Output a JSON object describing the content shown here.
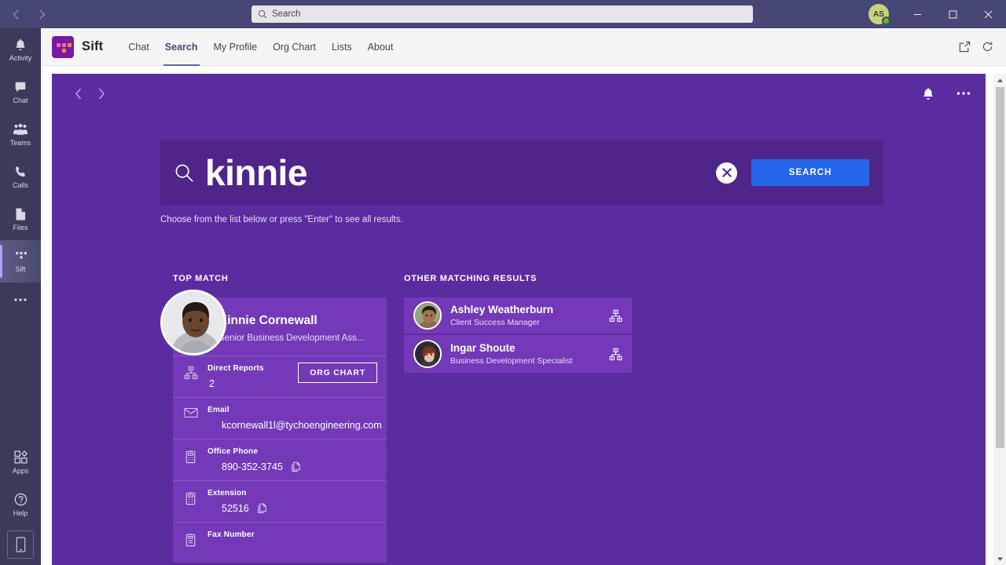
{
  "titlebar": {
    "back_label": "‹",
    "forward_label": "›",
    "search_placeholder": "Search",
    "search_icon": "search-icon",
    "avatar_initials": "AS",
    "minimize_label": "—",
    "maximize_label": "▢",
    "close_label": "✕"
  },
  "rail": {
    "items": [
      {
        "label": "Activity",
        "icon": "bell-icon"
      },
      {
        "label": "Chat",
        "icon": "chat-icon"
      },
      {
        "label": "Teams",
        "icon": "teams-icon"
      },
      {
        "label": "Calls",
        "icon": "phone-icon"
      },
      {
        "label": "Files",
        "icon": "files-icon"
      },
      {
        "label": "Sift",
        "icon": "sift-icon"
      }
    ],
    "more_label": "•••",
    "bottom": [
      {
        "label": "Apps",
        "icon": "apps-icon"
      },
      {
        "label": "Help",
        "icon": "help-icon"
      }
    ],
    "phone_icon": "mobile-device-icon"
  },
  "appheader": {
    "app_name": "Sift",
    "logo_icon": "sift-logo-icon",
    "tabs": [
      {
        "label": "Chat",
        "active": false
      },
      {
        "label": "Search",
        "active": true
      },
      {
        "label": "My Profile",
        "active": false
      },
      {
        "label": "Org Chart",
        "active": false
      },
      {
        "label": "Lists",
        "active": false
      },
      {
        "label": "About",
        "active": false
      }
    ],
    "popout_icon": "open-in-new-window-icon",
    "refresh_icon": "refresh-icon"
  },
  "panel": {
    "back_label": "‹",
    "forward_label": "›",
    "bell_icon": "notification-bell-icon",
    "more_icon": "more-options-icon"
  },
  "search": {
    "icon": "search-icon",
    "query": "kinnie",
    "clear_label": "✕",
    "submit_label": "SEARCH",
    "hint": "Choose from the list below or press \"Enter\" to see all results."
  },
  "top_match": {
    "section_title": "TOP MATCH",
    "avatar": "person-photo",
    "name": "Kinnie Cornewall",
    "title": "Senior Business Development Ass…",
    "fields": [
      {
        "label": "Direct Reports",
        "value": "2",
        "icon": "org-chart-icon",
        "button": "ORG CHART",
        "copyable": false
      },
      {
        "label": "Email",
        "value": "kcornewall1l@tychoengineering.com",
        "icon": "envelope-icon",
        "copyable": false
      },
      {
        "label": "Office Phone",
        "value": "890-352-3745",
        "icon": "desk-phone-icon",
        "copyable": true
      },
      {
        "label": "Extension",
        "value": "52516",
        "icon": "desk-phone-icon",
        "copyable": true
      },
      {
        "label": "Fax Number",
        "value": "",
        "icon": "fax-icon",
        "copyable": true
      }
    ]
  },
  "other_results": {
    "section_title": "OTHER MATCHING RESULTS",
    "items": [
      {
        "name": "Ashley Weatherburn",
        "role": "Client Success Manager",
        "avatar": "person-photo",
        "org_icon": "org-chart-icon"
      },
      {
        "name": "Ingar Shoute",
        "role": "Business Development Specialist",
        "avatar": "person-photo",
        "org_icon": "org-chart-icon"
      }
    ]
  },
  "scrollbar": {
    "up_label": "▲",
    "down_label": "▼"
  },
  "colors": {
    "titlebar": "#464775",
    "rail": "#3b3a5a",
    "panel_purple": "#5b2ca0",
    "hero_purple": "#4f2589",
    "card_purple": "#7339b8",
    "accent_blue": "#2566e8",
    "brand_purple": "#7719aa",
    "presence_green": "#6bb700"
  }
}
